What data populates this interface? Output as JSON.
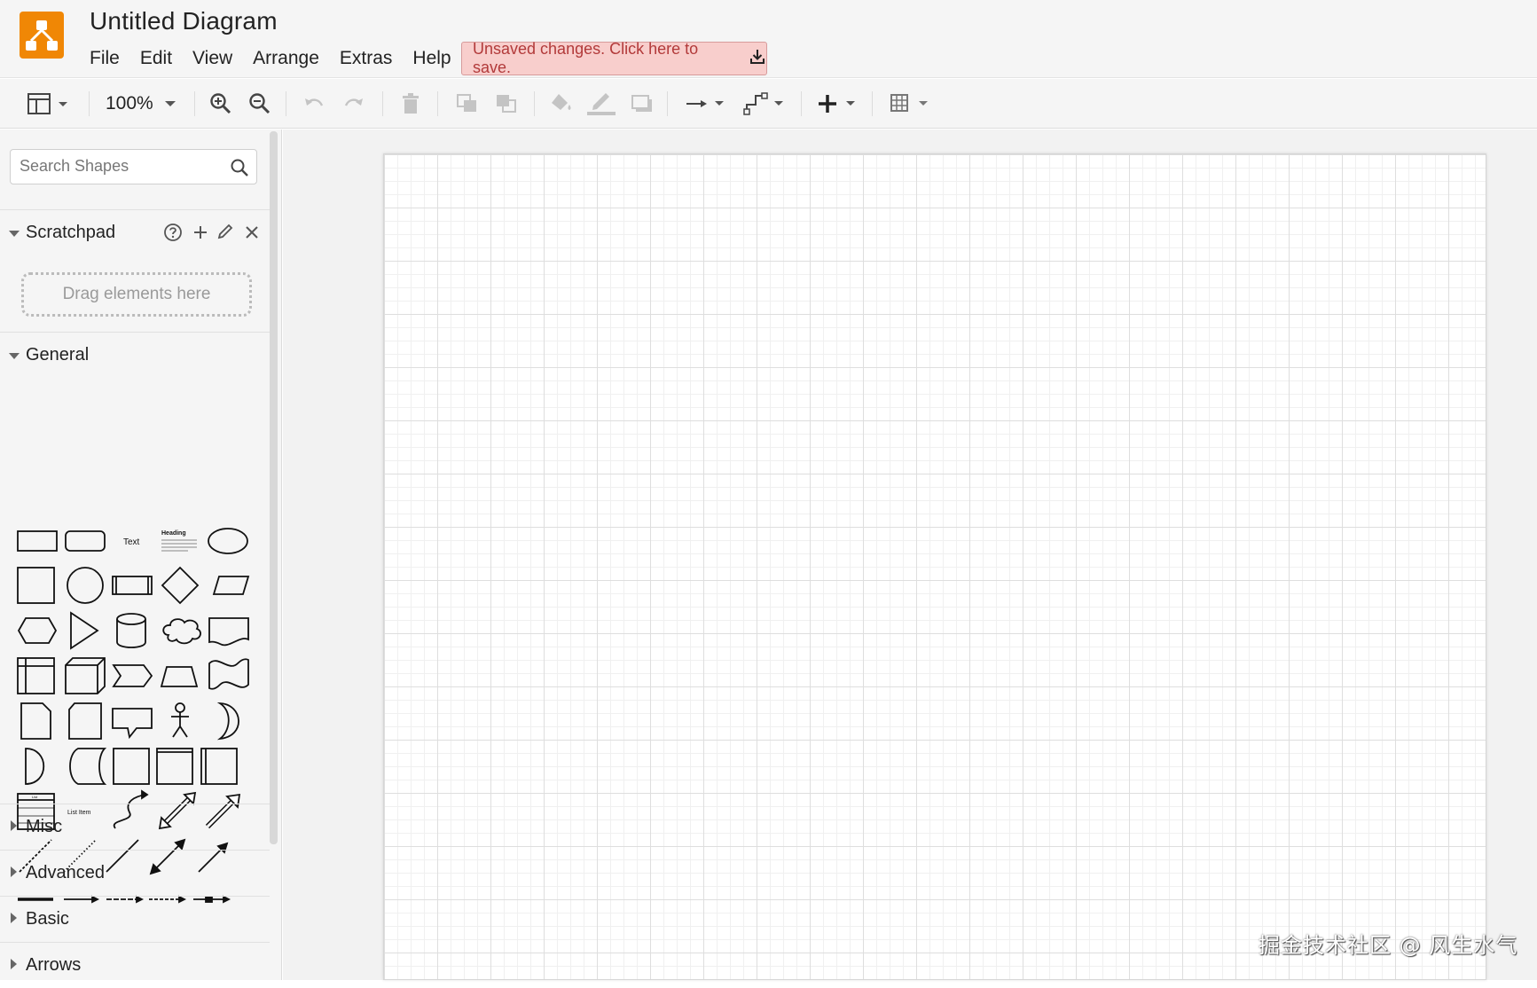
{
  "app": {
    "title": "Untitled Diagram",
    "logo_color": "#f08705",
    "menu": [
      "File",
      "Edit",
      "View",
      "Arrange",
      "Extras",
      "Help"
    ],
    "save_banner": {
      "text": "Unsaved changes. Click here to save.",
      "icon": "download-icon",
      "bg": "#f8cecc",
      "text_color": "#b23a3a"
    }
  },
  "toolbar": {
    "zoom": "100%",
    "tools": [
      "format-panel-icon",
      "zoom-in-icon",
      "zoom-out-icon",
      "undo-icon",
      "redo-icon",
      "delete-icon",
      "to-front-icon",
      "to-back-icon",
      "fill-color-icon",
      "line-color-icon",
      "shadow-icon",
      "connection-icon",
      "waypoints-icon",
      "insert-plus-icon",
      "table-icon"
    ]
  },
  "sidebar": {
    "search_placeholder": "Search Shapes",
    "scratchpad": {
      "label": "Scratchpad",
      "drop_text": "Drag elements here"
    },
    "general": {
      "label": "General",
      "text_shape": "Text",
      "heading_shape": "Heading",
      "list_item_shape": "List Item",
      "list_shape": "List"
    },
    "collapsed_sections": [
      "Misc",
      "Advanced",
      "Basic",
      "Arrows"
    ]
  },
  "watermark": "掘金技术社区 @ 风生水气"
}
